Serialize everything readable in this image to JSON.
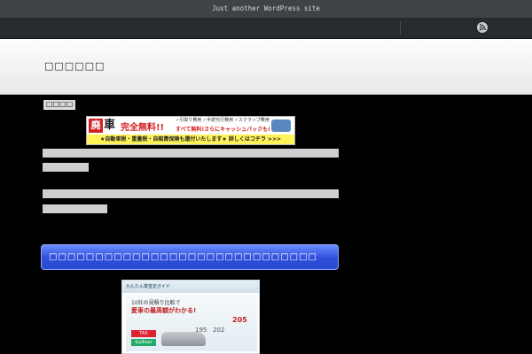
{
  "topbar": {
    "tagline": "Just another WordPress site"
  },
  "header": {
    "site_title": "□□□□□□"
  },
  "post": {
    "title": "□□□□",
    "section_heading": "□□□□□□□□□□□□□□□□□□□□□□□□□□□□□"
  },
  "banner": {
    "kanji1": "廃",
    "kanji2": "車",
    "main": "完全無料!!",
    "sub1": "✓引取り費用 ✓手続代行費用 ✓スクラップ費用",
    "sub2": "すべて無料!さらにキャッシュバックも!",
    "strip": "★自動車税・重量税・自賠責保険も還付いたします★ 詳しくはコチラ >>>"
  },
  "ad": {
    "head": "かんたん車査定ガイド",
    "line1": "10社の見積り比較で",
    "line2": "愛車の最高額がわかる!",
    "num1": "195",
    "num2": "202",
    "num3": "205",
    "tax": "TAX",
    "gulliver": "Gulliver"
  },
  "colors": {
    "topbar": "#3f4347",
    "navbar": "#272a2e",
    "heading_blue": "#2d4fdb",
    "page_bg": "#000000"
  },
  "icons": {
    "feed": "rss-icon"
  }
}
